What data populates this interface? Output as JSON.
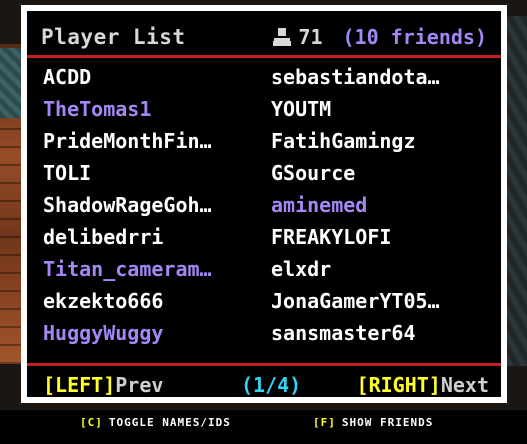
{
  "header": {
    "title": "Player List",
    "count": "71",
    "friends": "(10 friends)",
    "icon": "person-icon"
  },
  "colors": {
    "friend": "#a487f5",
    "normal": "#ffffff",
    "divider": "#c41e22",
    "key": "#ffff2a",
    "page": "#33d1f2"
  },
  "rows": [
    {
      "left": {
        "name": "ACDD",
        "friend": false
      },
      "right": {
        "name": "sebastiandota…",
        "friend": false
      }
    },
    {
      "left": {
        "name": "TheTomas1",
        "friend": true
      },
      "right": {
        "name": "YOUTM",
        "friend": false
      }
    },
    {
      "left": {
        "name": "PrideMonthFin…",
        "friend": false
      },
      "right": {
        "name": "FatihGamingz",
        "friend": false
      }
    },
    {
      "left": {
        "name": "TOLI",
        "friend": false
      },
      "right": {
        "name": "GSource",
        "friend": false
      }
    },
    {
      "left": {
        "name": "ShadowRageGoh…",
        "friend": false
      },
      "right": {
        "name": "aminemed",
        "friend": true
      }
    },
    {
      "left": {
        "name": "delibedrri",
        "friend": false
      },
      "right": {
        "name": "FREAKYLOFI",
        "friend": false
      }
    },
    {
      "left": {
        "name": "Titan_cameram…",
        "friend": true
      },
      "right": {
        "name": "elxdr",
        "friend": false
      }
    },
    {
      "left": {
        "name": "ekzekto666",
        "friend": false
      },
      "right": {
        "name": "JonaGamerYT05…",
        "friend": false
      }
    },
    {
      "left": {
        "name": "HuggyWuggy",
        "friend": true
      },
      "right": {
        "name": "sansmaster64",
        "friend": false
      }
    }
  ],
  "footer": {
    "prev_key": "[LEFT]",
    "prev_label": "Prev",
    "page": "(1/4)",
    "next_key": "[RIGHT]",
    "next_label": "Next"
  },
  "hints": {
    "toggle_key": "[C]",
    "toggle_label": "TOGGLE NAMES/IDS",
    "friends_key": "[F]",
    "friends_label": "SHOW FRIENDS"
  }
}
